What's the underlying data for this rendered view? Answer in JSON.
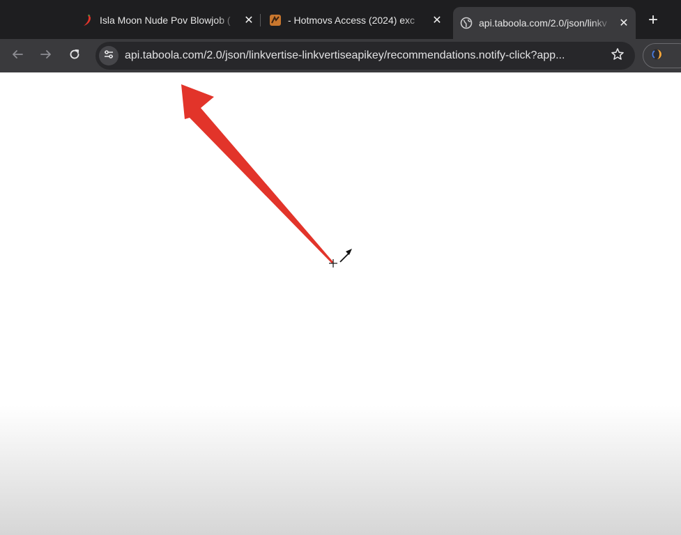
{
  "tabs": [
    {
      "title": "Isla Moon Nude Pov Blowjob (",
      "favicon": "chili-pepper-icon",
      "close": "✕"
    },
    {
      "title": "- Hotmovs Access (2024) exc",
      "favicon": "hotmovs-logo-icon",
      "close": "✕"
    },
    {
      "title": "api.taboola.com/2.0/json/linkv",
      "favicon": "globe-icon",
      "close": "✕",
      "active": true
    }
  ],
  "new_tab_label": "+",
  "toolbar": {
    "back": "arrow-left-icon",
    "forward": "arrow-right-icon",
    "reload": "reload-icon",
    "site_info": "tune-icon",
    "bookmark": "star-icon",
    "profile": "extension-icon"
  },
  "omnibox": {
    "url": "api.taboola.com/2.0/json/linkvertise-linkvertiseapikey/recommendations.notify-click?app..."
  },
  "colors": {
    "tabstrip": "#1e1e20",
    "toolbar": "#3a3a3d",
    "omnibox": "#27272a",
    "annotation_arrow": "#e2342a"
  }
}
